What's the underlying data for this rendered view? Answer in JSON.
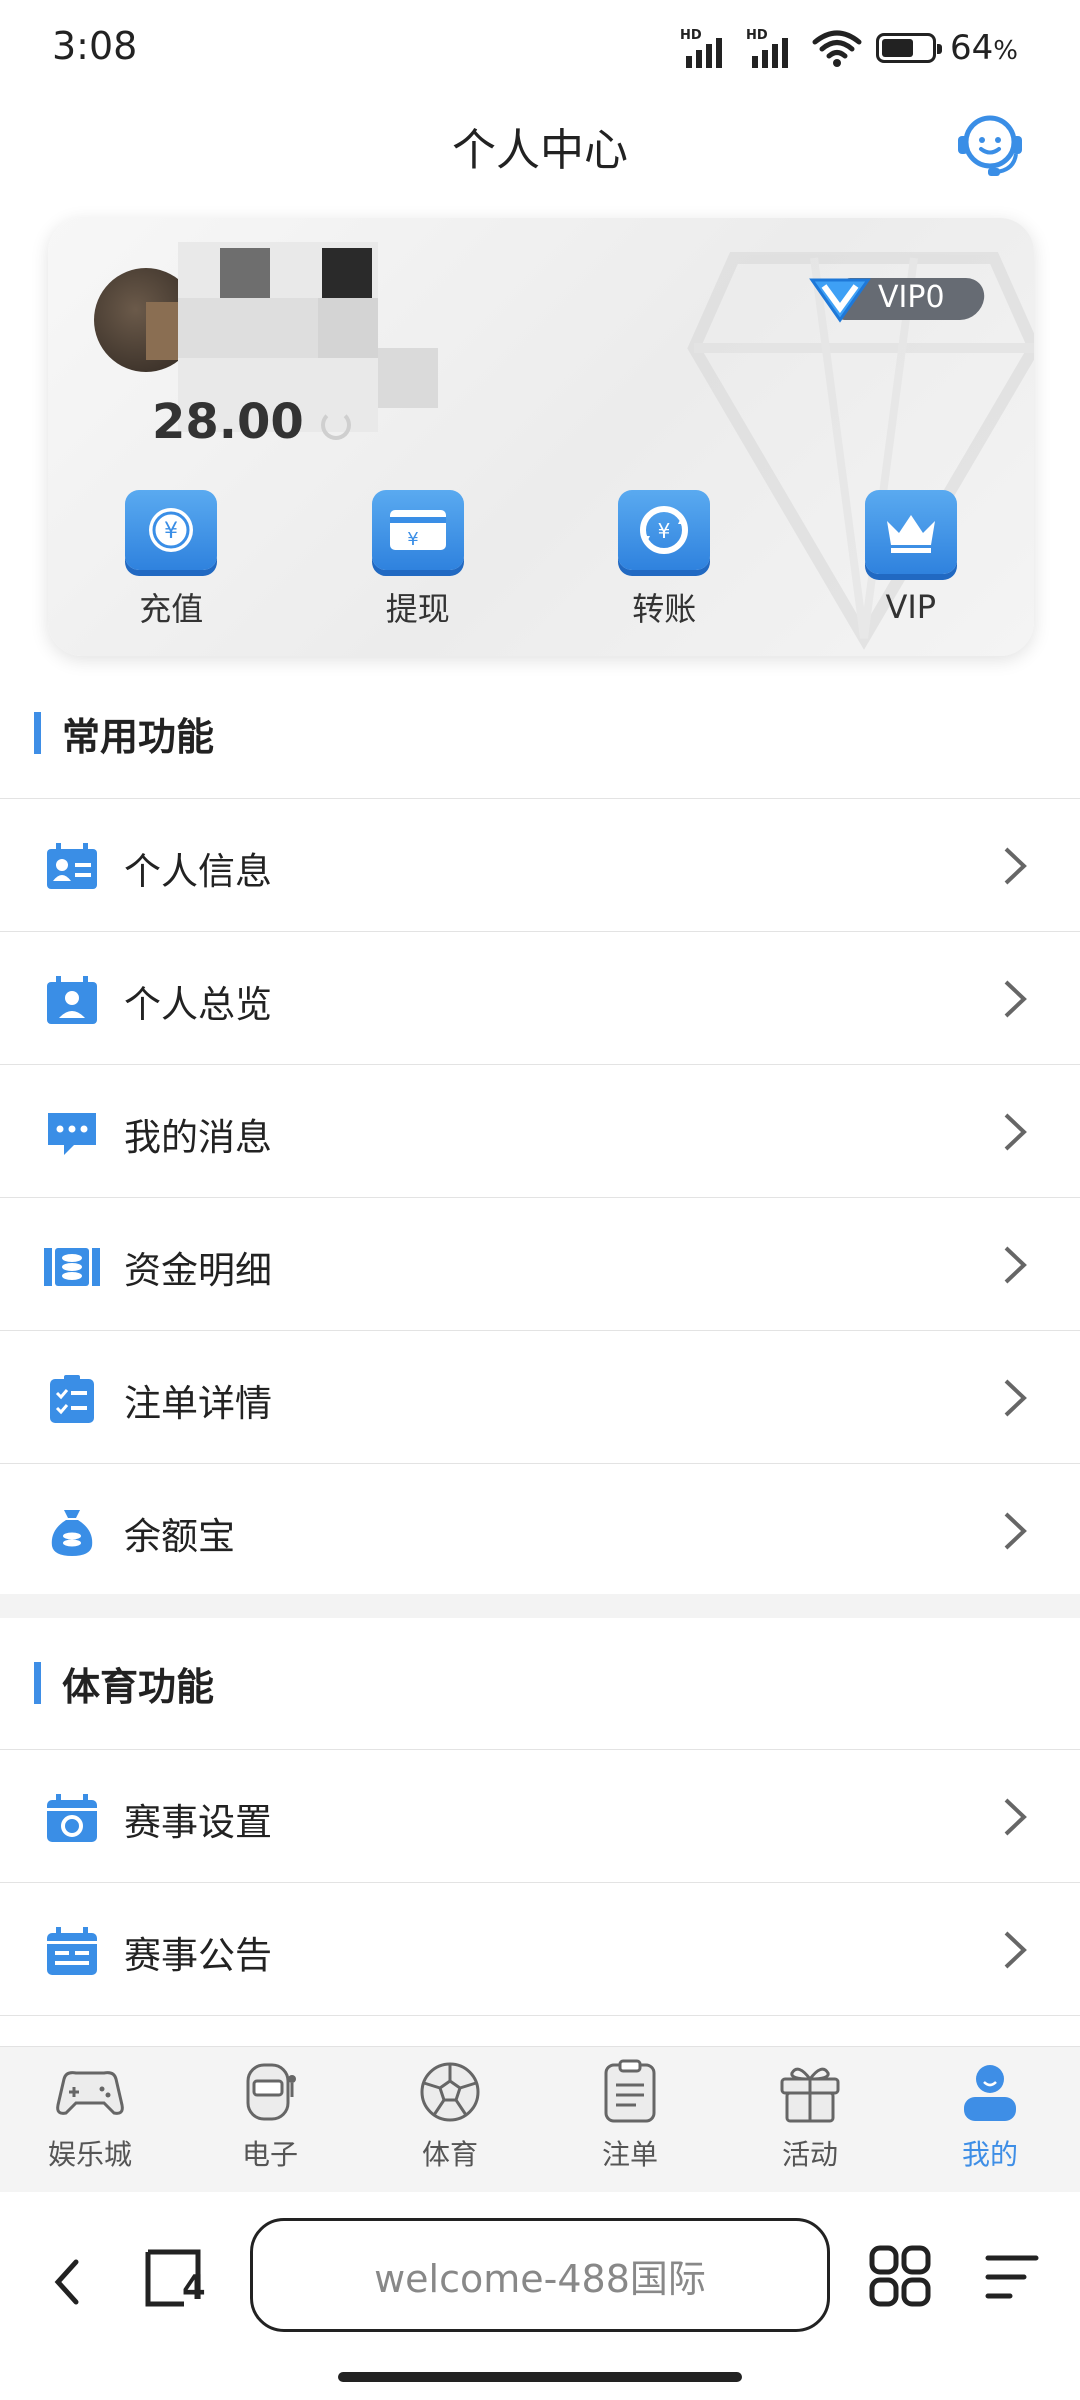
{
  "status_bar": {
    "time": "3:08",
    "battery_percent": "64",
    "battery_suffix": "%",
    "battery_level": 0.64,
    "signal_label": "HD"
  },
  "header": {
    "title": "个人中心",
    "support_icon": "customer-service-icon"
  },
  "profile": {
    "balance": "28.00",
    "vip_level": "VIP0",
    "actions": [
      {
        "label": "充值",
        "icon": "yuan-coin-icon"
      },
      {
        "label": "提现",
        "icon": "card-withdraw-icon"
      },
      {
        "label": "转账",
        "icon": "transfer-icon"
      },
      {
        "label": "VIP",
        "icon": "crown-icon"
      }
    ]
  },
  "sections": [
    {
      "title": "常用功能",
      "items": [
        {
          "label": "个人信息",
          "icon": "id-card-icon"
        },
        {
          "label": "个人总览",
          "icon": "profile-calendar-icon"
        },
        {
          "label": "我的消息",
          "icon": "message-icon"
        },
        {
          "label": "资金明细",
          "icon": "fund-ticket-icon"
        },
        {
          "label": "注单详情",
          "icon": "checklist-icon"
        },
        {
          "label": "余额宝",
          "icon": "money-bag-icon"
        }
      ]
    },
    {
      "title": "体育功能",
      "items": [
        {
          "label": "赛事设置",
          "icon": "calendar-settings-icon"
        },
        {
          "label": "赛事公告",
          "icon": "calendar-notice-icon"
        }
      ]
    }
  ],
  "tabbar": {
    "active_index": 5,
    "active_color": "#3e8ee6",
    "items": [
      {
        "label": "娱乐城",
        "icon": "gamepad-icon"
      },
      {
        "label": "电子",
        "icon": "slot-machine-icon"
      },
      {
        "label": "体育",
        "icon": "soccer-ball-icon"
      },
      {
        "label": "注单",
        "icon": "clipboard-icon"
      },
      {
        "label": "活动",
        "icon": "gift-icon"
      },
      {
        "label": "我的",
        "icon": "user-icon"
      }
    ]
  },
  "browser": {
    "url_text": "welcome-488国际",
    "tab_count": "4"
  },
  "colors": {
    "accent": "#3e8ee6",
    "icon_blue": "#3a8ee6"
  }
}
